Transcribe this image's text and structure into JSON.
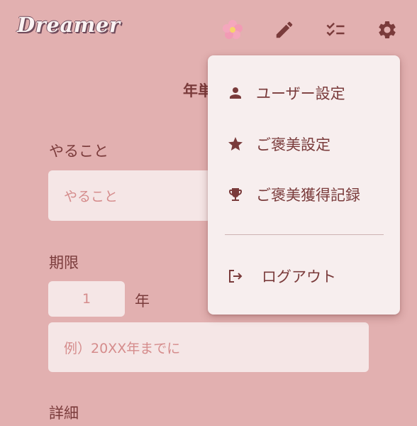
{
  "header": {
    "logo": "Dreamer",
    "icons": [
      "flower-icon",
      "pencil-icon",
      "checklist-icon",
      "gear-icon"
    ]
  },
  "page": {
    "heading": "年単"
  },
  "form": {
    "todo_label": "やること",
    "todo_placeholder": "やること",
    "deadline_label": "期限",
    "year_value": "1",
    "year_unit": "年",
    "example_placeholder": "例）20XX年までに",
    "details_label": "詳細"
  },
  "menu": {
    "items": [
      {
        "label": "ユーザー設定",
        "icon": "person-icon"
      },
      {
        "label": "ご褒美設定",
        "icon": "star-icon"
      },
      {
        "label": "ご褒美獲得記録",
        "icon": "trophy-icon"
      }
    ],
    "logout_label": "ログアウト",
    "logout_icon": "logout-icon"
  },
  "colors": {
    "background": "#e2b0b0",
    "field": "#f5e6e6",
    "menu": "#f7eeee",
    "text": "#7a3b3b",
    "placeholder": "#d58c8c"
  }
}
